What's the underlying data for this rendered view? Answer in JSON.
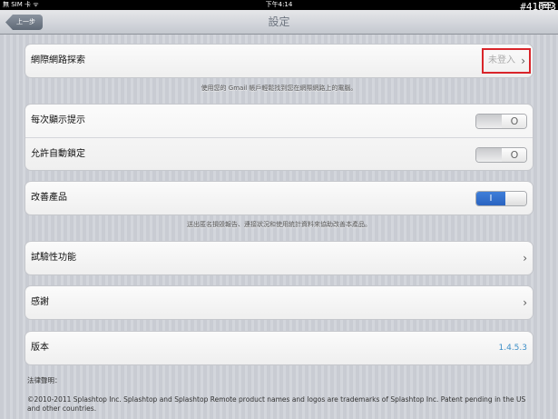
{
  "status": {
    "carrier": "無 SIM 卡 ᯤ",
    "time": "下午4:14"
  },
  "watermark": "#41643",
  "nav": {
    "back_label": "上一步",
    "title": "設定"
  },
  "network": {
    "label": "網際網路探索",
    "value": "未登入",
    "note": "使用您的 Gmail 帳戶輕鬆找到您在網際網路上的電腦。"
  },
  "toggles": [
    {
      "label": "每次顯示提示",
      "knob": "O"
    },
    {
      "label": "允許自動鎖定",
      "knob": "O"
    }
  ],
  "improve": {
    "label": "改善產品",
    "on_mark": "I",
    "note": "送出匿名損毀報告、連接狀況和使用統計資料來協助改善本產品。"
  },
  "experimental": {
    "label": "試驗性功能"
  },
  "thanks": {
    "label": "感謝"
  },
  "version": {
    "label": "版本",
    "value": "1.4.5.3"
  },
  "legal": {
    "heading": "法律聲明：",
    "text": "©2010-2011 Splashtop Inc. Splashtop and Splashtop Remote product names and logos are trademarks of Splashtop Inc. Patent pending in the US and other countries."
  },
  "chevron": "›"
}
